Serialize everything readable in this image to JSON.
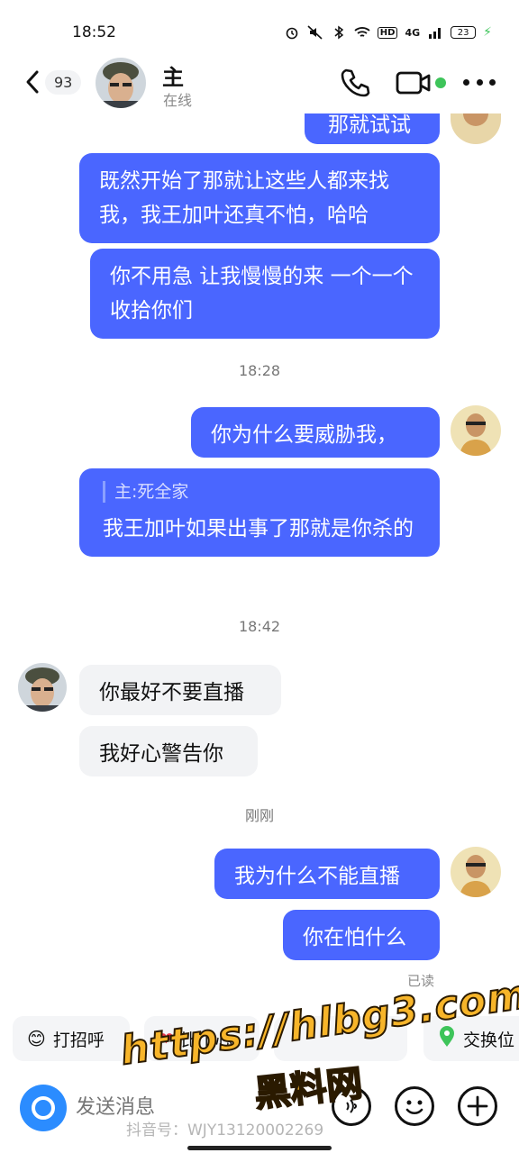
{
  "status_bar": {
    "time": "18:52",
    "battery": "23",
    "network": "4G",
    "hd": "HD"
  },
  "header": {
    "unread_count": "93",
    "contact_name": "主",
    "contact_status": "在线"
  },
  "messages": [
    {
      "side": "out",
      "text": "那就试试"
    },
    {
      "side": "out",
      "text": "既然开始了那就让这些人都来找我，我王加叶还真不怕，哈哈"
    },
    {
      "side": "out",
      "text": "你不用急 让我慢慢的来 一个一个收拾你们"
    },
    {
      "side": "out",
      "text": "你为什么要威胁我，"
    },
    {
      "side": "out",
      "quote": "主:死全家",
      "text": "我王加叶如果出事了那就是你杀的"
    },
    {
      "side": "in",
      "text": "你最好不要直播"
    },
    {
      "side": "in",
      "text": "我好心警告你"
    },
    {
      "side": "out",
      "text": "我为什么不能直播"
    },
    {
      "side": "out",
      "text": "你在怕什么"
    }
  ],
  "timestamps": [
    "18:28",
    "18:42",
    "刚刚"
  ],
  "read_receipt": "已读",
  "quick_replies": [
    {
      "emoji": "😊",
      "label": "打招呼"
    },
    {
      "emoji": "❤",
      "label": "比个心"
    },
    {
      "emoji": "",
      "label": ""
    },
    {
      "emoji": "📍",
      "label": "交换位"
    }
  ],
  "input": {
    "placeholder": "发送消息"
  },
  "watermark": {
    "url": "https://hlbg3.com",
    "name": "黑料网",
    "id": "抖音号：WJY13120002269"
  },
  "colors": {
    "out_bubble": "#4a66ff",
    "in_bubble": "#f2f3f5",
    "online": "#3ec45a",
    "camera": "#2b8cff"
  }
}
